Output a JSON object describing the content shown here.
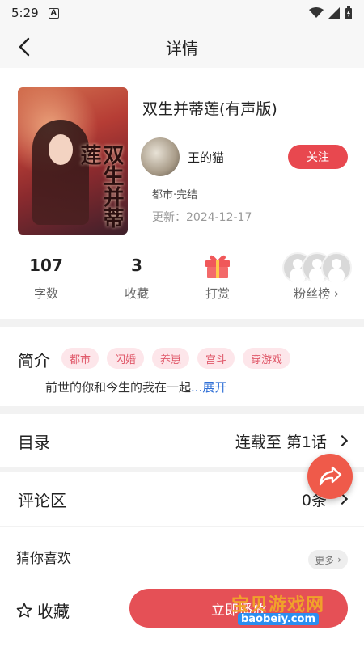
{
  "status": {
    "time": "5:29",
    "badge": "A"
  },
  "header": {
    "title": "详情"
  },
  "book": {
    "title": "双生并蒂莲(有声版)",
    "cover_text": "双生并蒂莲",
    "author": "王的猫",
    "follow_label": "关注",
    "genre": "都市·完结",
    "update": "更新：2024-12-17"
  },
  "stats": {
    "words_value": "107",
    "words_label": "字数",
    "favorites_value": "3",
    "favorites_label": "收藏",
    "reward_label": "打赏",
    "fans_label": "粉丝榜"
  },
  "intro": {
    "title": "简介",
    "tags": [
      "都市",
      "闪婚",
      "养崽",
      "宫斗",
      "穿游戏"
    ],
    "text": "前世的你和今生的我在一起",
    "expand": "...展开"
  },
  "catalog": {
    "label": "目录",
    "value": "连载至 第1话"
  },
  "comments": {
    "label": "评论区",
    "value": "0条"
  },
  "guess": {
    "title": "猜你喜欢",
    "more": "更多"
  },
  "bottom": {
    "favorite_label": "收藏",
    "listen_label": "立即播放"
  },
  "watermark": {
    "text": "宝贝游戏网",
    "url": "baobeiy.com"
  },
  "colors": {
    "accent": "#e8484f",
    "tag_bg": "#fde6ea",
    "tag_text": "#e05a6b",
    "link": "#2f6fd6"
  }
}
